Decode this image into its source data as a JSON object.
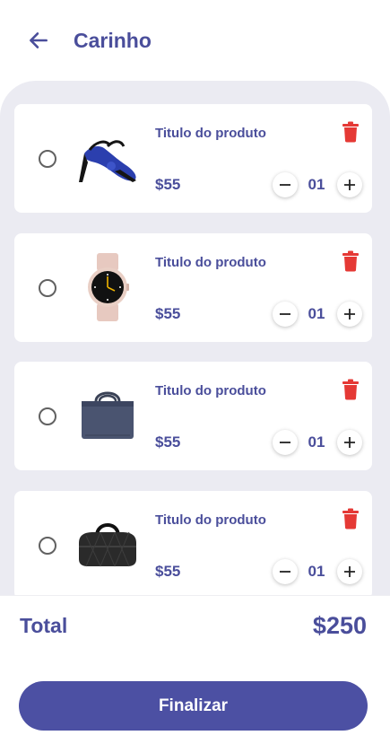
{
  "header": {
    "title": "Carinho",
    "back_icon": "arrow-left-icon"
  },
  "colors": {
    "primary": "#4a4e9b",
    "button": "#4c50a3",
    "delete": "#e53935",
    "sheet": "#ebebf2"
  },
  "cart": {
    "items": [
      {
        "title": "Titulo do produto",
        "price": "$55",
        "qty": "01",
        "image": "sandal-image"
      },
      {
        "title": "Titulo do produto",
        "price": "$55",
        "qty": "01",
        "image": "smartwatch-image"
      },
      {
        "title": "Titulo do produto",
        "price": "$55",
        "qty": "01",
        "image": "laptop-bag-image"
      },
      {
        "title": "Titulo do produto",
        "price": "$55",
        "qty": "01",
        "image": "duffel-bag-image"
      }
    ]
  },
  "footer": {
    "total_label": "Total",
    "total_value": "$250",
    "finish_label": "Finalizar"
  }
}
